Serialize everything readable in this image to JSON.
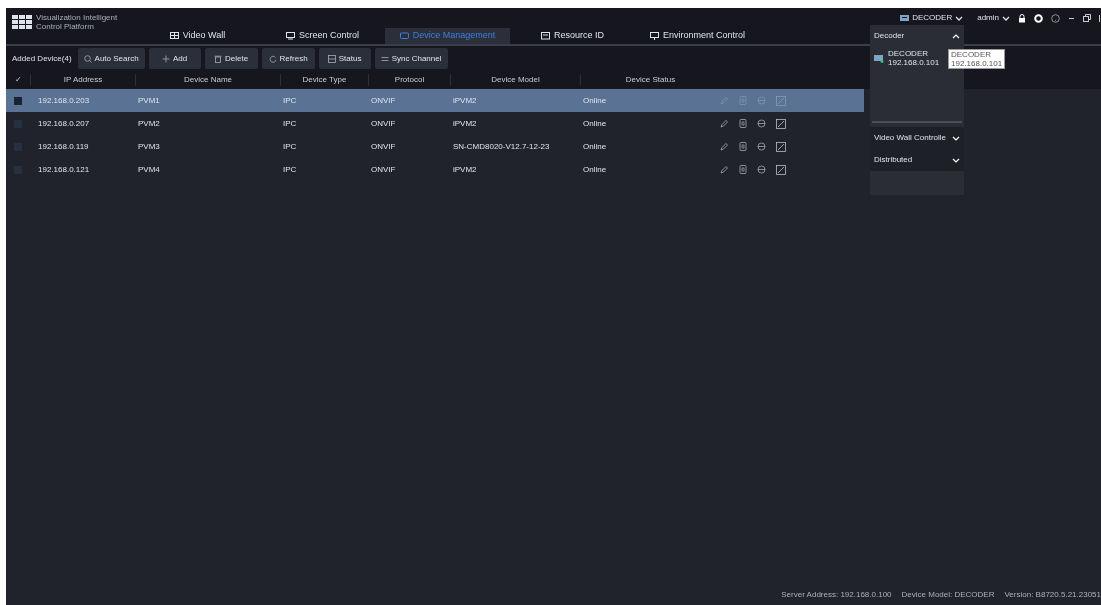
{
  "app": {
    "title_line_1": "Visualization Intelligent",
    "title_line_2": "Control Platform"
  },
  "tabs": [
    {
      "label": "Video Wall",
      "selected": false
    },
    {
      "label": "Screen Control",
      "selected": false
    },
    {
      "label": "Device Management",
      "selected": true
    },
    {
      "label": "Resource ID",
      "selected": false
    },
    {
      "label": "Environment Control",
      "selected": false
    }
  ],
  "header_right": {
    "device": "DECODER",
    "user": "admin"
  },
  "toolbar": {
    "label": "Added Device(4)",
    "buttons": [
      "Auto Search",
      "Add",
      "Delete",
      "Refresh",
      "Status",
      "Sync Channel"
    ]
  },
  "table": {
    "check_header": "✓",
    "columns": [
      "IP Address",
      "Device Name",
      "Device Type",
      "Protocol",
      "Device Model",
      "Device Status"
    ],
    "rows": [
      {
        "cells": [
          "192.168.0.203",
          "PVM1",
          "IPC",
          "ONVIF",
          "iPVM2",
          "Online"
        ],
        "selected": true
      },
      {
        "cells": [
          "192.168.0.207",
          "PVM2",
          "IPC",
          "ONVIF",
          "iPVM2",
          "Online"
        ],
        "selected": false
      },
      {
        "cells": [
          "192.168.0.119",
          "PVM3",
          "IPC",
          "ONVIF",
          "SN-CMD8020-V12.7-12-23",
          "Online"
        ],
        "selected": false
      },
      {
        "cells": [
          "192.168.0.121",
          "PVM4",
          "IPC",
          "ONVIF",
          "iPVM2",
          "Online"
        ],
        "selected": false
      }
    ]
  },
  "device_panel": {
    "sections": [
      {
        "label": "Decoder",
        "expanded": true,
        "items": [
          {
            "name": "DECODER",
            "ip": "192.168.0.101"
          }
        ]
      },
      {
        "label": "Video Wall Controlle",
        "expanded": false
      },
      {
        "label": "Distributed",
        "expanded": false
      }
    ],
    "tooltip": {
      "line_1": "DECODER",
      "line_2": "192.168.0.101"
    }
  },
  "status_bar": [
    "Server Address: 192.168.0.100",
    "Device Model: DECODER",
    "Version: B8720.5.21.23051"
  ]
}
